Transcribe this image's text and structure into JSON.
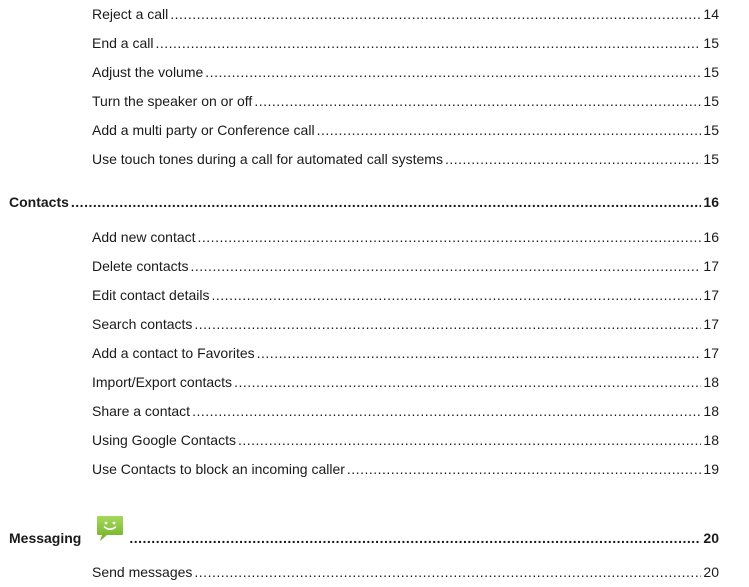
{
  "toc": {
    "call_items": [
      {
        "label": "Reject a call",
        "page": "14"
      },
      {
        "label": "End a call",
        "page": "15"
      },
      {
        "label": "Adjust the volume",
        "page": "15"
      },
      {
        "label": "Turn the speaker on or off",
        "page": "15"
      },
      {
        "label": "Add a multi party or Conference call",
        "page": "15"
      },
      {
        "label": "Use touch tones during a call for automated call systems",
        "page": "15"
      }
    ],
    "contacts": {
      "label": "Contacts",
      "page": "16",
      "items": [
        {
          "label": "Add new contact",
          "page": "16"
        },
        {
          "label": "Delete contacts",
          "page": "17"
        },
        {
          "label": "Edit contact details",
          "page": "17"
        },
        {
          "label": "Search contacts",
          "page": "17"
        },
        {
          "label": "Add a contact to Favorites",
          "page": "17"
        },
        {
          "label": "Import/Export contacts",
          "page": "18"
        },
        {
          "label": "Share a contact",
          "page": "18"
        },
        {
          "label": "Using Google Contacts",
          "page": "18"
        },
        {
          "label": "Use Contacts to block an incoming caller",
          "page": "19"
        }
      ]
    },
    "messaging": {
      "label": "Messaging",
      "page": "20",
      "icon": "messaging-app-icon",
      "icon_color": "#8cc63f",
      "items": [
        {
          "label": "Send messages",
          "page": "20"
        }
      ]
    }
  }
}
